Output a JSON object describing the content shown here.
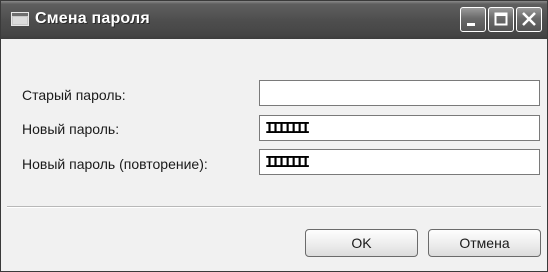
{
  "window": {
    "title": "Смена пароля",
    "icon": "app-window-icon",
    "controls": [
      "minimize-icon",
      "maximize-icon",
      "close-icon"
    ]
  },
  "form": {
    "old_password_label": "Старый пароль:",
    "old_password_value": "",
    "new_password_label": "Новый пароль:",
    "new_password_value": "IIIIIII",
    "repeat_password_label": "Новый пароль (повторение):",
    "repeat_password_value": "IIIIIII"
  },
  "buttons": {
    "ok_label": "OK",
    "cancel_label": "Отмена"
  }
}
